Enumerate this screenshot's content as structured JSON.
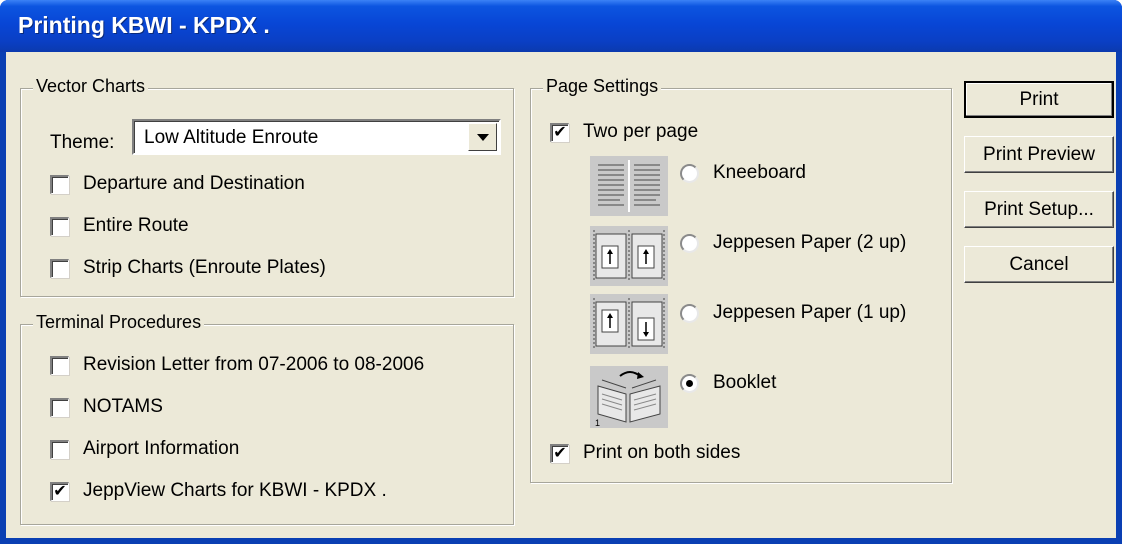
{
  "window": {
    "title": "Printing KBWI - KPDX ."
  },
  "vector_charts": {
    "legend": "Vector Charts",
    "theme_label": "Theme:",
    "theme_value": "Low Altitude Enroute",
    "options": [
      {
        "label": "Departure and Destination",
        "checked": false
      },
      {
        "label": "Entire Route",
        "checked": false
      },
      {
        "label": "Strip Charts  (Enroute Plates)",
        "checked": false
      }
    ]
  },
  "terminal_procedures": {
    "legend": "Terminal Procedures",
    "options": [
      {
        "label": "Revision Letter from 07-2006 to 08-2006",
        "checked": false
      },
      {
        "label": "NOTAMS",
        "checked": false
      },
      {
        "label": "Airport Information",
        "checked": false
      },
      {
        "label": "JeppView Charts for KBWI - KPDX .",
        "checked": true
      }
    ]
  },
  "page_settings": {
    "legend": "Page Settings",
    "two_per_page": {
      "label": "Two per page",
      "checked": true
    },
    "layouts": [
      {
        "label": "Kneeboard",
        "selected": false,
        "icon": "kneeboard-layout-icon"
      },
      {
        "label": "Jeppesen Paper (2 up)",
        "selected": false,
        "icon": "jeppesen-2up-layout-icon"
      },
      {
        "label": "Jeppesen Paper (1 up)",
        "selected": false,
        "icon": "jeppesen-1up-layout-icon"
      },
      {
        "label": "Booklet",
        "selected": true,
        "icon": "booklet-layout-icon"
      }
    ],
    "both_sides": {
      "label": "Print on both sides",
      "checked": true
    }
  },
  "buttons": {
    "print": "Print",
    "print_preview": "Print Preview",
    "print_setup": "Print Setup...",
    "cancel": "Cancel"
  },
  "colors": {
    "titlebar": "#0a46d6",
    "dialog_face": "#ece9d8"
  },
  "glyphs": {
    "check": "✔"
  }
}
